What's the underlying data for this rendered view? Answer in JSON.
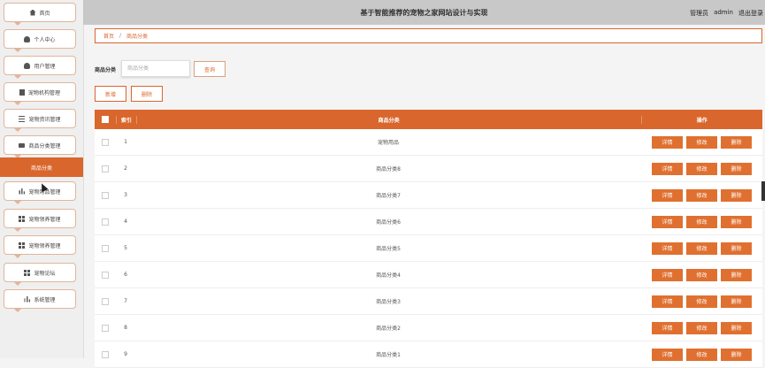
{
  "header": {
    "title": "基于智能推荐的宠物之家网站设计与实现",
    "role": "管理员",
    "username": "admin",
    "logout": "退出登录"
  },
  "sidebar": {
    "items": [
      {
        "label": "首页",
        "icon": "home-icon"
      },
      {
        "label": "个人中心",
        "icon": "user-icon"
      },
      {
        "label": "用户管理",
        "icon": "user-icon"
      },
      {
        "label": "宠物机构管理",
        "icon": "doc-icon"
      },
      {
        "label": "宠物资讯管理",
        "icon": "sliders-icon"
      },
      {
        "label": "商品分类管理",
        "icon": "screen-icon"
      },
      {
        "label": "宠物用品管理",
        "icon": "bar-chart-icon"
      },
      {
        "label": "宠物领养管理",
        "icon": "grid-icon"
      },
      {
        "label": "宠物领养管理",
        "icon": "grid-icon"
      },
      {
        "label": "宠物论坛",
        "icon": "grid-icon"
      },
      {
        "label": "系统管理",
        "icon": "bar-chart-icon"
      }
    ],
    "active_sub": "商品分类"
  },
  "breadcrumb": {
    "home": "首页",
    "separator": "/",
    "current": "商品分类"
  },
  "search": {
    "label": "商品分类",
    "placeholder": "商品分类",
    "query_label": "查询"
  },
  "toolbar": {
    "add_label": "新增",
    "delete_label": "删除"
  },
  "table": {
    "headers": {
      "index": "索引",
      "name": "商品分类",
      "ops": "操作"
    },
    "ops": {
      "detail": "详情",
      "edit": "修改",
      "delete": "删除"
    },
    "rows": [
      {
        "index": "1",
        "name": "宠物用品"
      },
      {
        "index": "2",
        "name": "商品分类8"
      },
      {
        "index": "3",
        "name": "商品分类7"
      },
      {
        "index": "4",
        "name": "商品分类6"
      },
      {
        "index": "5",
        "name": "商品分类5"
      },
      {
        "index": "6",
        "name": "商品分类4"
      },
      {
        "index": "7",
        "name": "商品分类3"
      },
      {
        "index": "8",
        "name": "商品分类2"
      },
      {
        "index": "9",
        "name": "商品分类1"
      }
    ]
  },
  "colors": {
    "accent": "#d9662c",
    "button": "#e07030",
    "header_bg": "#c8c8c8"
  }
}
